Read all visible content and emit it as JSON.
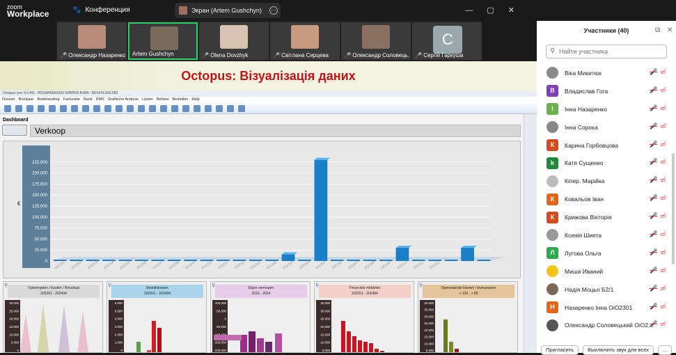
{
  "app": {
    "brand_line1": "zoom",
    "brand_line2": "Workplace",
    "meeting_label": "Конференция",
    "screen_share_label": "Экран (Artem Gushchyn)"
  },
  "video_strip": [
    {
      "name": "Олександр Назаренко",
      "muted": true
    },
    {
      "name": "Artem Gushchyn",
      "muted": false,
      "active": true
    },
    {
      "name": "Olena Dovzhyk",
      "muted": true
    },
    {
      "name": "Світлана Сирцева",
      "muted": true
    },
    {
      "name": "Олександр Соловець...",
      "muted": true
    },
    {
      "name": "Сергій Гаркуша",
      "muted": true,
      "avatar_letter": "C"
    }
  ],
  "slide": {
    "title": "Octopus: Візуалізація даних"
  },
  "erp": {
    "window_title": "Octopus (ver 9.0-49) - BOUWWERKEN SPAPEN BVBA - BE0474.603.580",
    "menu": [
      "Dossier",
      "Boekjaar",
      "Boekhouding",
      "Facturatie",
      "Bank",
      "DMS",
      "Grafische Analyse",
      "Lijsten",
      "Beheer",
      "Bestellen",
      "Help"
    ],
    "dashboard_label": "Dashboard",
    "section_title": "Verkoop",
    "panels": [
      {
        "title": "Opbrengsten / Kosten / Resultaat",
        "period": "202201 - 202404",
        "color": "#d9d9d9"
      },
      {
        "title": "Bedrijfskosten",
        "period": "202201 - 202404",
        "color": "#a9d3ea"
      },
      {
        "title": "Eigen vermogen",
        "period": "2016 - 2024",
        "color": "#e6cce8"
      },
      {
        "title": "Financiële middelen",
        "period": "202201 - 202404",
        "color": "#f3cfc8"
      },
      {
        "title": "Openstaande klanten / leveranciers",
        "period": "< 120 - > 89",
        "color": "#e6c49a"
      }
    ]
  },
  "chart_data": [
    {
      "type": "bar",
      "ylabel": "€",
      "yticks": [
        "0",
        "25.000",
        "50.000",
        "75.000",
        "100.000",
        "125.000",
        "150.000",
        "175.000",
        "200.000",
        "225.000"
      ],
      "ylim": [
        0,
        250000
      ],
      "categories": [
        "202201",
        "202202",
        "202203",
        "202204",
        "202205",
        "202206",
        "202207",
        "202208",
        "202209",
        "202210",
        "202211",
        "202212",
        "202301",
        "202302",
        "202303",
        "202304",
        "202305",
        "202306",
        "202307",
        "202308",
        "202309",
        "202310",
        "202311",
        "202312"
      ],
      "values": [
        0,
        0,
        0,
        0,
        0,
        0,
        0,
        0,
        0,
        0,
        0,
        0,
        0,
        0,
        15000,
        0,
        230000,
        0,
        0,
        0,
        0,
        30000,
        0,
        0,
        0,
        30000,
        0
      ],
      "colors": {
        "bar": "#1b7fc8"
      }
    },
    {
      "type": "area",
      "yticks": [
        "30.000",
        "25.000",
        "20.000",
        "15.000",
        "10.000",
        "5.000",
        "0"
      ]
    },
    {
      "type": "bar",
      "yticks": [
        "6.000",
        "5.000",
        "4.000",
        "3.000",
        "2.000",
        "1.000",
        "0"
      ]
    },
    {
      "type": "bar",
      "yticks": [
        "100.000",
        "50.000",
        "0",
        "-50.000",
        "-100.000",
        "-150.000",
        "-200.000"
      ]
    },
    {
      "type": "bar",
      "yticks": [
        "35.000",
        "30.000",
        "25.000",
        "20.000",
        "15.000",
        "10.000",
        "5.000"
      ]
    },
    {
      "type": "bar",
      "yticks": [
        "40.000",
        "35.000",
        "30.000",
        "25.000",
        "20.000",
        "15.000",
        "10.000",
        "5.000"
      ]
    }
  ],
  "participants": {
    "header": "Участники (40)",
    "search_placeholder": "Найти участника",
    "list": [
      {
        "name": "Віка Микитюк",
        "color": "#8a8a8a",
        "letter": ""
      },
      {
        "name": "Владислав Гога",
        "color": "#7b3fb6",
        "letter": "В"
      },
      {
        "name": "Інна Назаренко",
        "color": "#6ab04c",
        "letter": "І"
      },
      {
        "name": "Інна Сорока",
        "color": "#888",
        "letter": ""
      },
      {
        "name": "Карина Горбовцова",
        "color": "#d34b1f",
        "letter": "К"
      },
      {
        "name": "Катя Сущенко",
        "color": "#1f8a3a",
        "letter": "k"
      },
      {
        "name": "Кіпер. Марійка",
        "color": "#bbb",
        "letter": ""
      },
      {
        "name": "Ковальов Іван",
        "color": "#e0681d",
        "letter": "К"
      },
      {
        "name": "Крижова Вікторія",
        "color": "#d34b1f",
        "letter": "К"
      },
      {
        "name": "Ксенія Шията",
        "color": "#999",
        "letter": ""
      },
      {
        "name": "Лугова Ольга",
        "color": "#2ea84f",
        "letter": "Л"
      },
      {
        "name": "Миша Иваний",
        "color": "#f0c419",
        "letter": ""
      },
      {
        "name": "Надія Моцьо Б2/1",
        "color": "#7a6a55",
        "letter": ""
      },
      {
        "name": "Назаренко Інна ОіО2301",
        "color": "#e0681d",
        "letter": "Н"
      },
      {
        "name": "Олександр Соловецький ОіО2...",
        "color": "#555",
        "letter": ""
      }
    ],
    "invite_label": "Пригласить",
    "mute_all_label": "Выключить звук для всех",
    "more_label": "..."
  }
}
